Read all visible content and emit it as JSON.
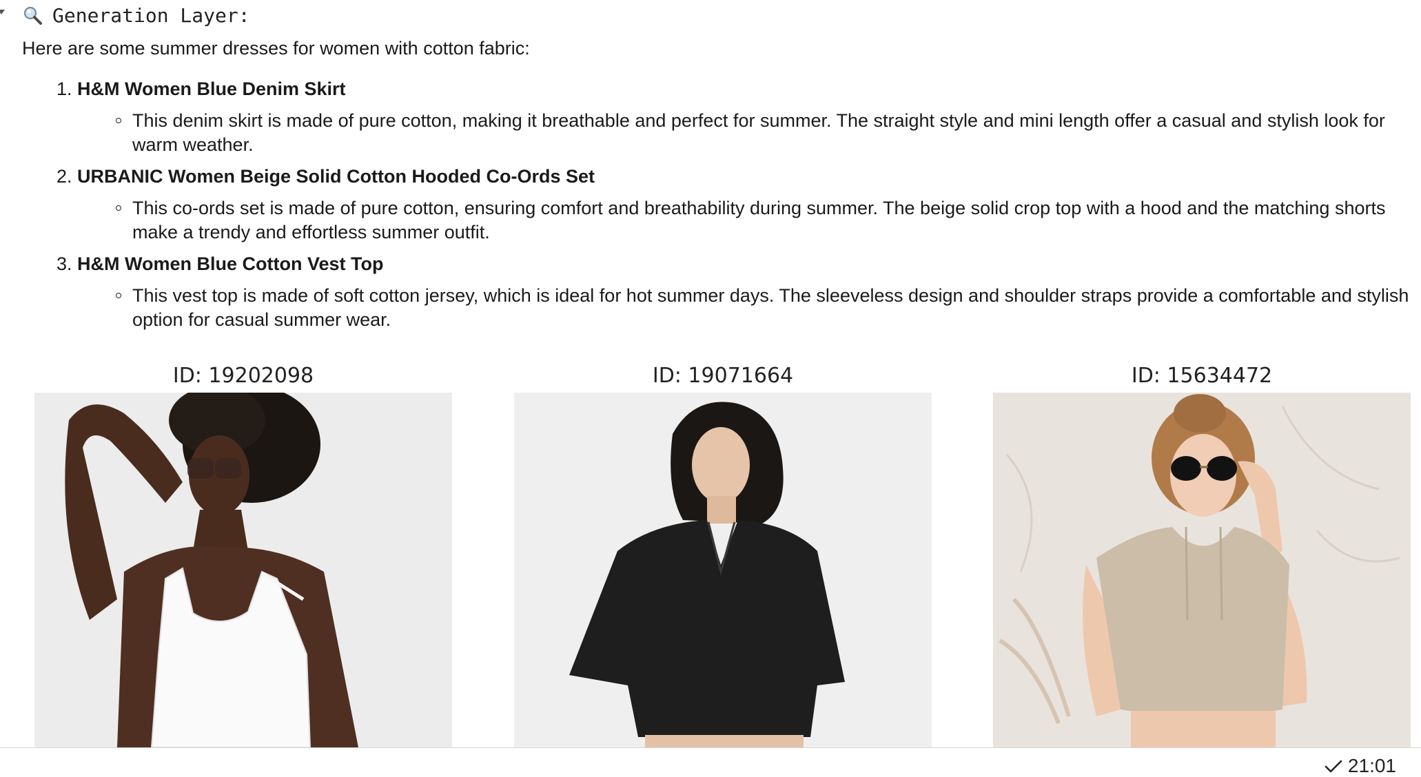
{
  "header": {
    "icon": "magnifier-icon",
    "title": "Generation Layer:"
  },
  "intro": "Here are some summer dresses for women with cotton fabric:",
  "items": [
    {
      "number": "1.",
      "title": "H&M Women Blue Denim Skirt",
      "description": "This denim skirt is made of pure cotton, making it breathable and perfect for summer. The straight style and mini length offer a casual and stylish look for warm weather."
    },
    {
      "number": "2.",
      "title": "URBANIC Women Beige Solid Cotton Hooded Co-Ords Set",
      "description": "This co-ords set is made of pure cotton, ensuring comfort and breathability during summer. The beige solid crop top with a hood and the matching shorts make a trendy and effortless summer outfit."
    },
    {
      "number": "3.",
      "title": "H&M Women Blue Cotton Vest Top",
      "description": "This vest top is made of soft cotton jersey, which is ideal for hot summer days. The sleeveless design and shoulder straps provide a comfortable and stylish option for casual summer wear."
    }
  ],
  "products": [
    {
      "id_label": "ID: 19202098",
      "photo": "model-white-tank-top-sunglasses"
    },
    {
      "id_label": "ID: 19071664",
      "photo": "model-black-cropped-shirt"
    },
    {
      "id_label": "ID: 15634472",
      "photo": "model-beige-hooded-crop-top-sunglasses"
    }
  ],
  "status": {
    "icon": "checkmark-icon",
    "time": "21:01"
  },
  "colors": {
    "photo_bg_1": "#ededed",
    "photo_bg_2": "#efefef",
    "photo_bg_3": "#e8e2dc",
    "divider": "#d6d6d6"
  }
}
